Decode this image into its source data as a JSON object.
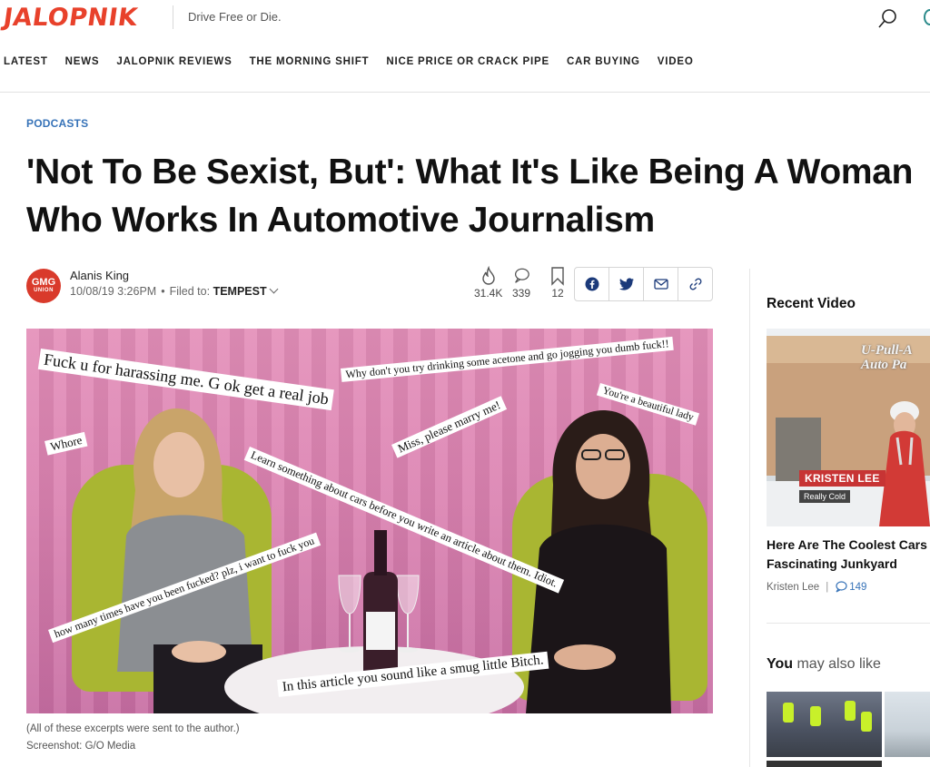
{
  "header": {
    "logo": "JALOPNIK",
    "tagline": "Drive Free or Die."
  },
  "nav": {
    "items": [
      "LATEST",
      "NEWS",
      "JALOPNIK REVIEWS",
      "THE MORNING SHIFT",
      "NICE PRICE OR CRACK PIPE",
      "CAR BUYING",
      "VIDEO"
    ]
  },
  "article": {
    "category": "PODCASTS",
    "headline_line1": "'Not To Be Sexist, But': What It's Like Being A Woman",
    "headline_line2": "Who Works In Automotive Journalism",
    "avatar_line1": "GMG",
    "avatar_line2": "UNION",
    "author": "Alanis King",
    "timestamp": "10/08/19 3:26PM",
    "filed_label": "Filed to:",
    "filed_tag": "TEMPEST",
    "stats": {
      "views": "31.4K",
      "comments": "339",
      "bookmarks": "12"
    },
    "hero_overlays": [
      "Fuck u for harassing me. G ok get a real job",
      "Why don't you try drinking some acetone and go jogging you dumb fuck!!",
      "You're a beautiful lady",
      "Whore",
      "Miss, please marry me!",
      "Learn something about cars before you write an article about them. Idiot.",
      "how many times have you been fucked? plz, i want to fuck you",
      "In this article you sound like a smug little Bitch."
    ],
    "caption": "(All of these excerpts were sent to the author.)",
    "credit": "Screenshot: G/O Media"
  },
  "sidebar": {
    "recent_title": "Recent Video",
    "thumb_sign": "U-Pull-A Auto Pa",
    "thumb_name": "KRISTEN LEE",
    "thumb_sub": "Really Cold",
    "recent_headline_1": "Here Are The Coolest Cars V",
    "recent_headline_2": "Fascinating Junkyard",
    "recent_author": "Kristen Lee",
    "recent_comments": "149",
    "also_bold": "You",
    "also_rest": " may also like"
  },
  "colors": {
    "brand": "#e8412b",
    "link": "#3773b8",
    "hero_bg": "#db82b1"
  }
}
